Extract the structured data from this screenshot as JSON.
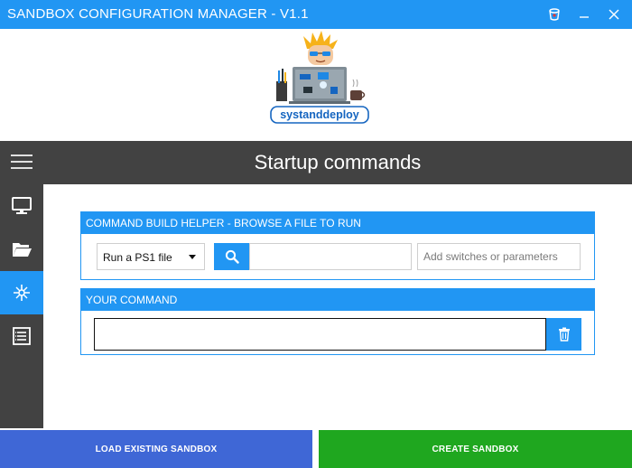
{
  "window": {
    "title": "SANDBOX CONFIGURATION MANAGER - V1.1"
  },
  "logo": {
    "text": "systanddeploy"
  },
  "header": {
    "page_title": "Startup commands"
  },
  "sidebar": {
    "items": [
      {
        "icon": "monitor-icon"
      },
      {
        "icon": "folder-open-icon"
      },
      {
        "icon": "startup-icon",
        "active": true
      },
      {
        "icon": "list-icon"
      }
    ]
  },
  "command_helper": {
    "header": "COMMAND BUILD HELPER - BROWSE A FILE TO RUN",
    "type_selected": "Run a PS1 file",
    "file_value": "",
    "params_placeholder": "Add switches or parameters"
  },
  "your_command": {
    "header": "YOUR COMMAND",
    "value": ""
  },
  "footer": {
    "load_label": "LOAD EXISTING SANDBOX",
    "create_label": "CREATE SANDBOX"
  },
  "colors": {
    "accent": "#2196f3",
    "dark": "#424242",
    "load_button": "#3f67d6",
    "create_button": "#1fa71f"
  }
}
